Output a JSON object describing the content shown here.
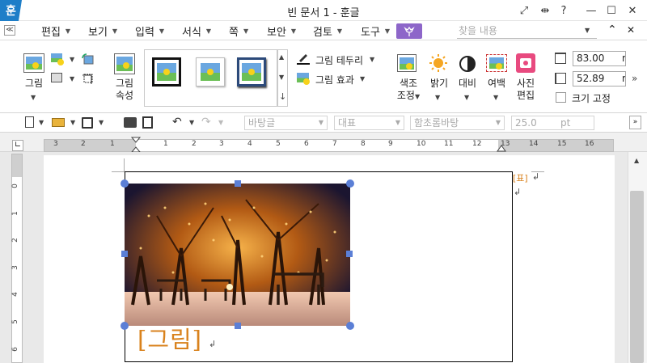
{
  "app": {
    "logo": "훈",
    "title": "빈 문서 1 - 훈글"
  },
  "window_controls": {
    "expand": "⤢",
    "split": "⇹",
    "help": "?",
    "minimize": "—",
    "maximize": "☐",
    "close": "✕"
  },
  "menu": {
    "collapse": "≪",
    "items": [
      {
        "label": "편집"
      },
      {
        "label": "보기"
      },
      {
        "label": "입력"
      },
      {
        "label": "서식"
      },
      {
        "label": "쪽"
      },
      {
        "label": "보안"
      },
      {
        "label": "검토"
      },
      {
        "label": "도구"
      }
    ],
    "find_placeholder": "찾을 내용",
    "nav_up": "⌃",
    "close_ribbon": "✕"
  },
  "ribbon": {
    "picture_label": "그림",
    "picture_props_label": [
      "그림",
      "속성"
    ],
    "border_label": "그림 테두리",
    "effect_label": "그림 효과",
    "color_adjust_label": [
      "색조",
      "조정"
    ],
    "brightness_label": "밝기",
    "contrast_label": "대비",
    "margin_label": "여백",
    "photo_edit_label": [
      "사진",
      "편집"
    ],
    "width_value": "83.00",
    "height_value": "52.89",
    "unit_cut": "m",
    "fix_size_label": "크기 고정",
    "more": "»"
  },
  "toolbar2": {
    "style": "바탕글",
    "paragraph": "대표",
    "font": "함초롬바탕",
    "size": "25.0",
    "size_unit": "pt"
  },
  "ruler": {
    "h_numbers": [
      "3",
      "2",
      "1",
      "1",
      "2",
      "3",
      "4",
      "5",
      "6",
      "7",
      "8",
      "9",
      "10",
      "11",
      "12",
      "13",
      "14",
      "15",
      "16",
      "17"
    ],
    "v_numbers": [
      "0",
      "1",
      "2",
      "3",
      "4",
      "5",
      "6",
      "7"
    ]
  },
  "document": {
    "table_tag": "[표]",
    "caption": "[그림]",
    "para_mark": "↲"
  },
  "colors": {
    "accent": "#1e7ec8",
    "handle": "#5b7fd6",
    "caption": "#d9821d",
    "style_button": "#8d66c9"
  }
}
